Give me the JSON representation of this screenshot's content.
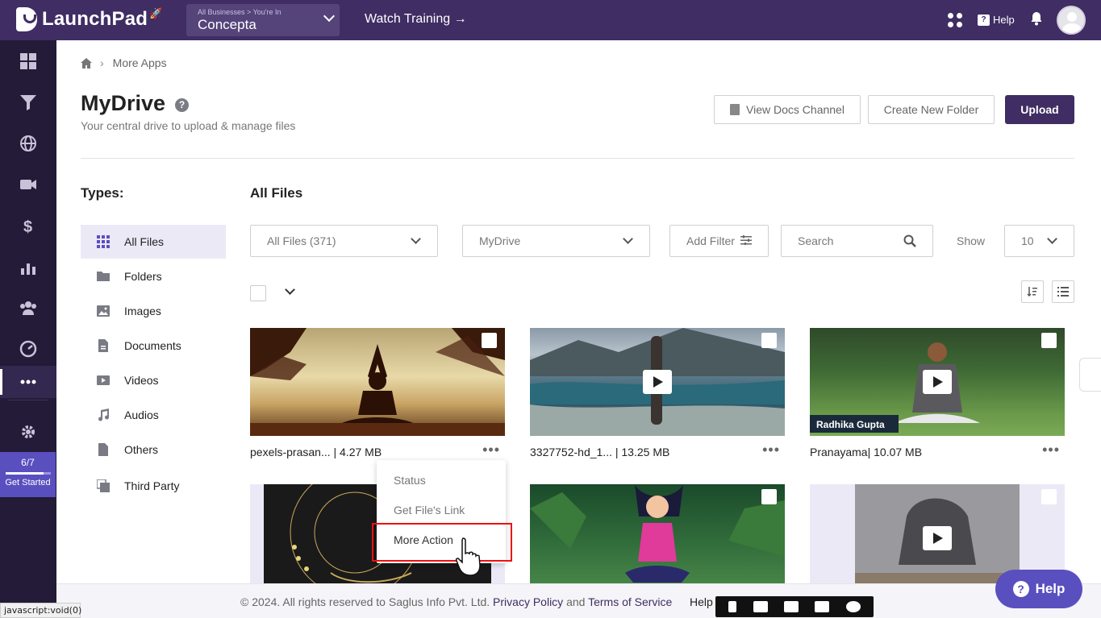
{
  "topbar": {
    "logo_text": "LaunchPad",
    "business_small": "All Businesses > You're In",
    "business_name": "Concepta",
    "watch_training": "Watch Training →",
    "help_label": "Help"
  },
  "sidebar": {
    "items": [
      "dashboard-icon",
      "funnel-icon",
      "globe-icon",
      "video-icon",
      "dollar-icon",
      "analytics-icon",
      "people-icon",
      "gauge-icon",
      "more-icon",
      "settings-icon"
    ],
    "get_started_count": "6/7",
    "get_started_label": "Get Started",
    "get_started_progress": 0.857
  },
  "breadcrumb": {
    "current": "More Apps"
  },
  "page": {
    "title": "MyDrive",
    "subtitle": "Your central drive to upload & manage files",
    "view_docs": "View Docs Channel",
    "create_folder": "Create New Folder",
    "upload": "Upload"
  },
  "types": {
    "heading": "Types:",
    "items": [
      {
        "label": "All Files",
        "icon": "grid-icon"
      },
      {
        "label": "Folders",
        "icon": "folder-icon"
      },
      {
        "label": "Images",
        "icon": "image-icon"
      },
      {
        "label": "Documents",
        "icon": "document-icon"
      },
      {
        "label": "Videos",
        "icon": "video-icon"
      },
      {
        "label": "Audios",
        "icon": "music-icon"
      },
      {
        "label": "Others",
        "icon": "file-icon"
      },
      {
        "label": "Third Party",
        "icon": "third-party-icon"
      }
    ]
  },
  "files": {
    "heading": "All Files",
    "filter_all": "All Files (371)",
    "filter_drive": "MyDrive",
    "add_filter": "Add Filter",
    "search_placeholder": "Search",
    "show_label": "Show",
    "show_value": "10",
    "cards": [
      {
        "caption": "pexels-prasan... | 4.27 MB",
        "type": "image"
      },
      {
        "caption": "3327752-hd_1... | 13.25 MB",
        "type": "video"
      },
      {
        "caption": "Pranayama| 10.07 MB",
        "type": "video",
        "overlay": "Radhika Gupta"
      },
      {
        "caption": "",
        "type": "image"
      },
      {
        "caption": "",
        "type": "image"
      },
      {
        "caption": "",
        "type": "video"
      }
    ]
  },
  "context_menu": {
    "items": [
      "Status",
      "Get File's Link",
      "More Action"
    ]
  },
  "footer": {
    "copyright": "©  2024. All rights reserved to Saglus Info Pvt. Ltd.",
    "privacy": "Privacy Policy",
    "and": "and",
    "terms": "Terms of Service",
    "help": "Help",
    "pipe": "|"
  },
  "help_fab": "Help",
  "status_url": "javascript:void(0)"
}
